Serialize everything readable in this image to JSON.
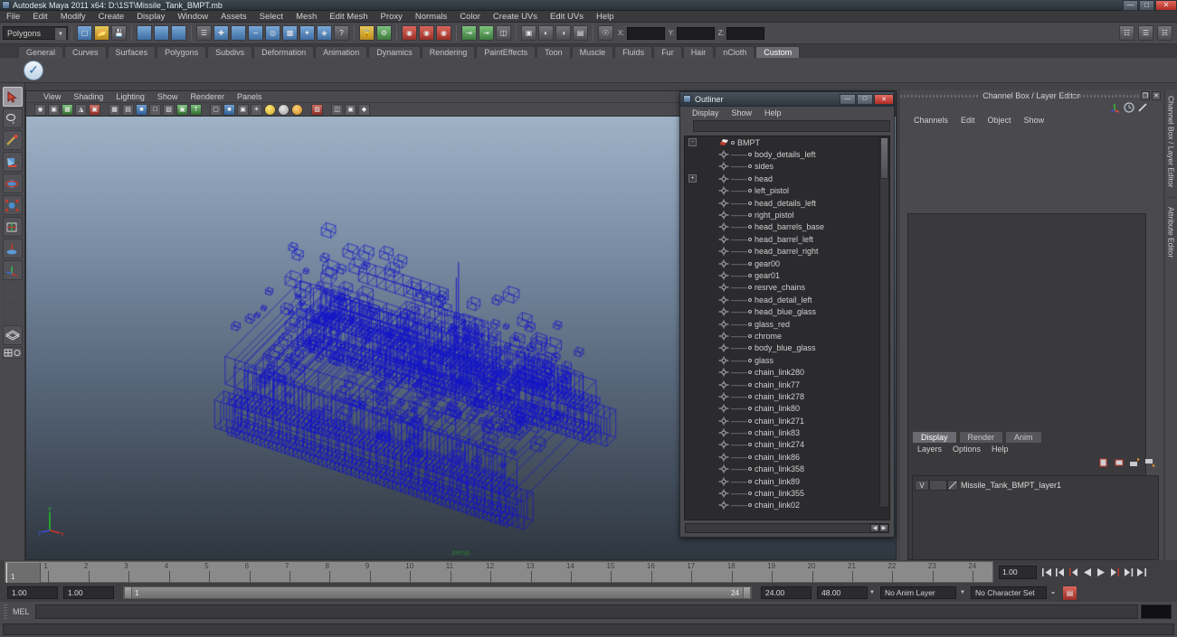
{
  "window": {
    "title": "Autodesk Maya 2011 x64: D:\\1ST\\Missile_Tank_BMPT.mb",
    "minimize": "—",
    "maximize": "□",
    "close": "✕"
  },
  "menubar": {
    "items": [
      "File",
      "Edit",
      "Modify",
      "Create",
      "Display",
      "Window",
      "Assets",
      "Select",
      "Mesh",
      "Edit Mesh",
      "Proxy",
      "Normals",
      "Color",
      "Create UVs",
      "Edit UVs",
      "Help"
    ]
  },
  "toolbar": {
    "mode_selector": "Polygons",
    "coord_labels": [
      "X:",
      "Y:",
      "Z:"
    ],
    "coord_values": [
      "",
      "",
      ""
    ]
  },
  "shelf": {
    "tabs": [
      "General",
      "Curves",
      "Surfaces",
      "Polygons",
      "Subdivs",
      "Deformation",
      "Animation",
      "Dynamics",
      "Rendering",
      "PaintEffects",
      "Toon",
      "Muscle",
      "Fluids",
      "Fur",
      "Hair",
      "nCloth",
      "Custom"
    ],
    "active_tab": "Custom"
  },
  "viewport": {
    "menu": [
      "View",
      "Shading",
      "Lighting",
      "Show",
      "Renderer",
      "Panels"
    ],
    "camera_label": "persp",
    "axis_labels": {
      "x": "x",
      "y": "Y",
      "z": "z"
    },
    "background_top": "#9fb2c6",
    "background_bottom": "#2f3740",
    "wireframe_color": "#1414c8"
  },
  "outliner": {
    "title": "Outliner",
    "window_buttons": {
      "minimize": "—",
      "maximize": "□",
      "close": "✕"
    },
    "menu": [
      "Display",
      "Show",
      "Help"
    ],
    "search_value": "",
    "root": {
      "label": "BMPT",
      "expander": "-"
    },
    "items": [
      {
        "label": "body_details_left",
        "expander": ""
      },
      {
        "label": "sides",
        "expander": ""
      },
      {
        "label": "head",
        "expander": "+"
      },
      {
        "label": "left_pistol",
        "expander": ""
      },
      {
        "label": "head_details_left",
        "expander": ""
      },
      {
        "label": "right_pistol",
        "expander": ""
      },
      {
        "label": "head_barrels_base",
        "expander": ""
      },
      {
        "label": "head_barrel_left",
        "expander": ""
      },
      {
        "label": "head_barrel_right",
        "expander": ""
      },
      {
        "label": "gear00",
        "expander": ""
      },
      {
        "label": "gear01",
        "expander": ""
      },
      {
        "label": "resrve_chains",
        "expander": ""
      },
      {
        "label": "head_detail_left",
        "expander": ""
      },
      {
        "label": "head_blue_glass",
        "expander": ""
      },
      {
        "label": "glass_red",
        "expander": ""
      },
      {
        "label": "chrome",
        "expander": ""
      },
      {
        "label": "body_blue_glass",
        "expander": ""
      },
      {
        "label": "glass",
        "expander": ""
      },
      {
        "label": "chain_link280",
        "expander": ""
      },
      {
        "label": "chain_link77",
        "expander": ""
      },
      {
        "label": "chain_link278",
        "expander": ""
      },
      {
        "label": "chain_link80",
        "expander": ""
      },
      {
        "label": "chain_link271",
        "expander": ""
      },
      {
        "label": "chain_link83",
        "expander": ""
      },
      {
        "label": "chain_link274",
        "expander": ""
      },
      {
        "label": "chain_link86",
        "expander": ""
      },
      {
        "label": "chain_link358",
        "expander": ""
      },
      {
        "label": "chain_link89",
        "expander": ""
      },
      {
        "label": "chain_link355",
        "expander": ""
      },
      {
        "label": "chain_link02",
        "expander": ""
      }
    ]
  },
  "channel_box": {
    "title": "Channel Box / Layer Editor",
    "restore_glyph": "❐",
    "close_glyph": "✕",
    "menu": [
      "Channels",
      "Edit",
      "Object",
      "Show"
    ],
    "rail_labels": [
      "Channel Box / Layer Editor",
      "Attribute Editor"
    ]
  },
  "layer_editor": {
    "tabs": [
      "Display",
      "Render",
      "Anim"
    ],
    "active_tab": "Display",
    "menu": [
      "Layers",
      "Options",
      "Help"
    ],
    "layers": [
      {
        "visibility": "V",
        "playback": "",
        "name": "Missile_Tank_BMPT_layer1"
      }
    ]
  },
  "timeline": {
    "ticks": [
      "1",
      "2",
      "3",
      "4",
      "5",
      "6",
      "7",
      "8",
      "9",
      "10",
      "11",
      "12",
      "13",
      "14",
      "15",
      "16",
      "17",
      "18",
      "19",
      "20",
      "21",
      "22",
      "23",
      "24"
    ],
    "current_frame_marker": "1",
    "current_time_field": "1.00",
    "playback_buttons": [
      "go-to-start",
      "step-back-key",
      "step-back-frame",
      "play-backwards",
      "play-forwards",
      "step-forward-frame",
      "step-forward-key",
      "go-to-end"
    ]
  },
  "range_slider": {
    "anim_start": "1.00",
    "range_start": "1.00",
    "bar_start_label": "1",
    "bar_end_label": "24",
    "range_end": "24.00",
    "anim_end": "48.00",
    "anim_layer": "No Anim Layer",
    "character_set": "No Character Set"
  },
  "command_line": {
    "language_label": "MEL",
    "input_value": "",
    "status_value": ""
  }
}
